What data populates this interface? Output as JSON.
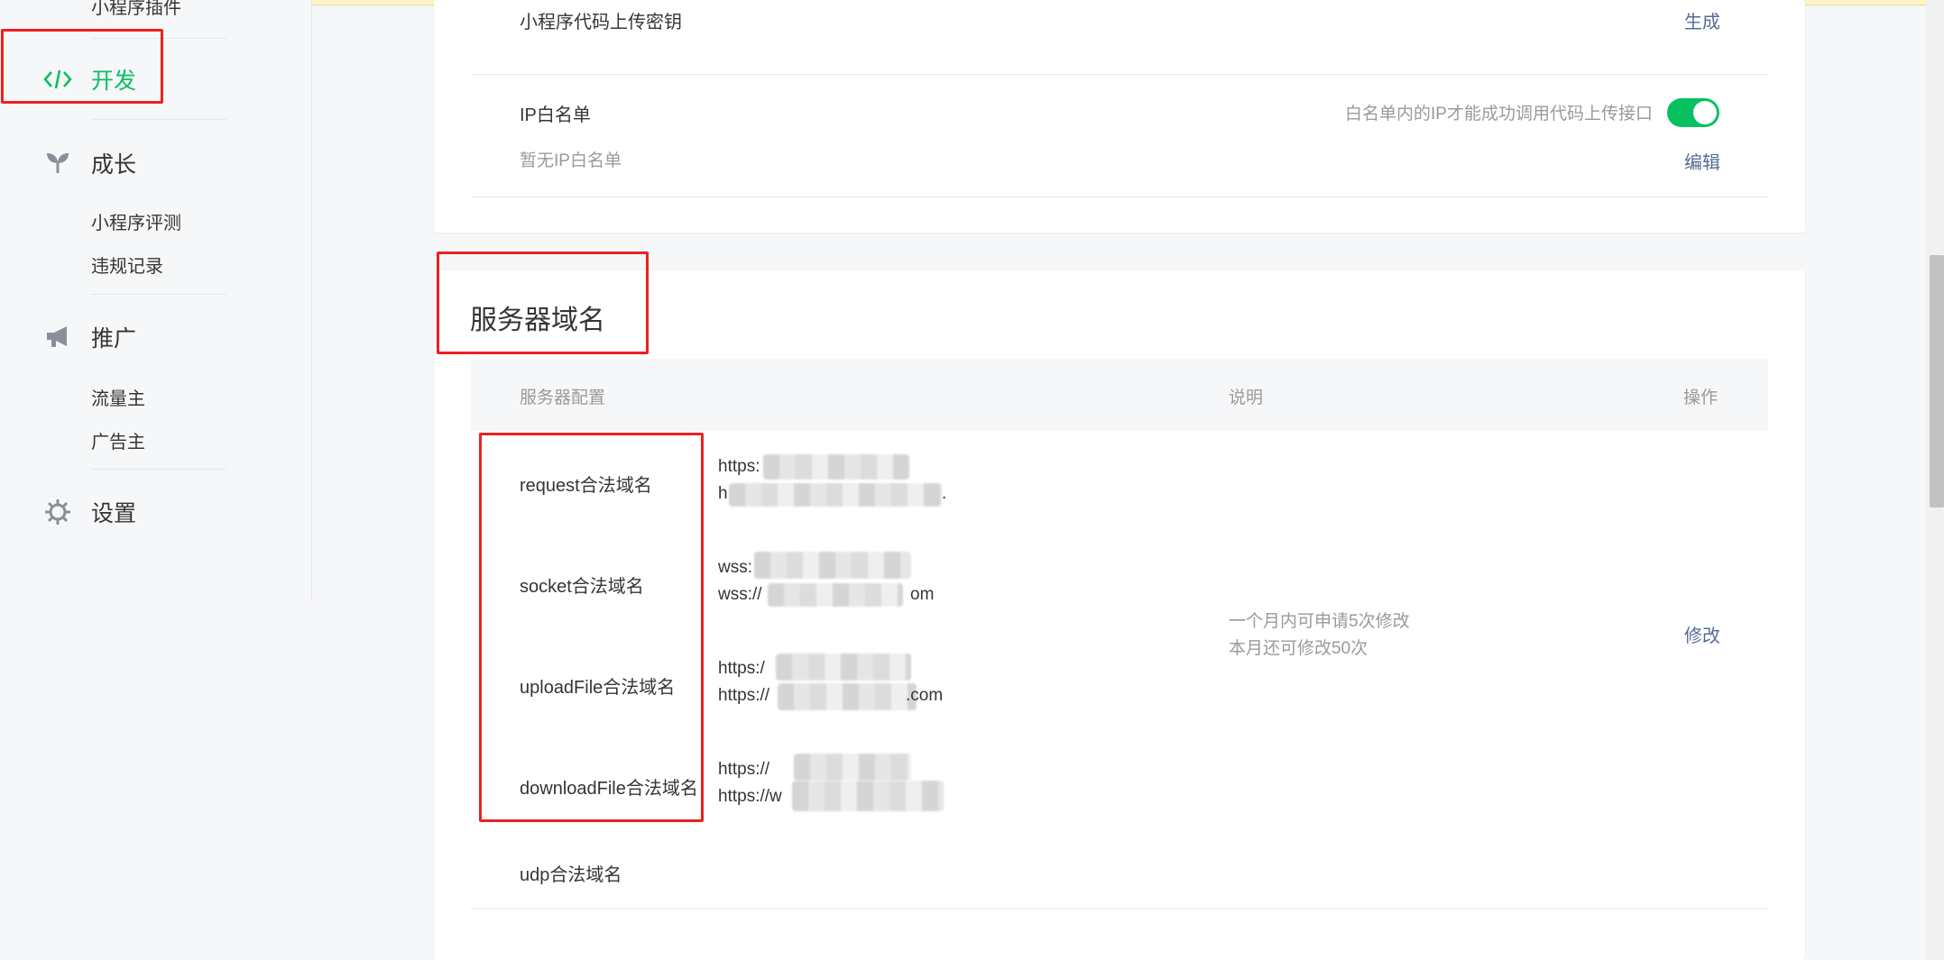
{
  "sidebar": {
    "top_cut_item": "小程序插件",
    "dev": {
      "label": "开发",
      "icon": "code-icon",
      "color": "#07c160"
    },
    "growth": {
      "label": "成长",
      "icon": "sprout-icon",
      "items": [
        "小程序评测",
        "违规记录"
      ]
    },
    "promo": {
      "label": "推广",
      "icon": "megaphone-icon",
      "items": [
        "流量主",
        "广告主"
      ]
    },
    "settings": {
      "label": "设置",
      "icon": "gear-icon"
    }
  },
  "upload_key": {
    "label": "小程序代码上传密钥",
    "action": "生成"
  },
  "ip_whitelist": {
    "label": "IP白名单",
    "status": "暂无IP白名单",
    "toggle_hint": "白名单内的IP才能成功调用代码上传接口",
    "toggle_on": true,
    "action": "编辑"
  },
  "server_domain": {
    "title": "服务器域名",
    "columns": {
      "config": "服务器配置",
      "desc": "说明",
      "action": "操作"
    },
    "rows": [
      {
        "name": "request合法域名",
        "urls": [
          "https:",
          "h"
        ],
        "url_tail": [
          "",
          "."
        ]
      },
      {
        "name": "socket合法域名",
        "urls": [
          "wss:",
          "wss://"
        ],
        "url_tail": [
          "",
          "om"
        ]
      },
      {
        "name": "uploadFile合法域名",
        "urls": [
          "https:/",
          "https://"
        ],
        "url_tail": [
          "",
          ".com"
        ]
      },
      {
        "name": "downloadFile合法域名",
        "urls": [
          "https://",
          "https://w"
        ],
        "url_tail": [
          "",
          ""
        ]
      },
      {
        "name": "udp合法域名",
        "urls": [],
        "url_tail": []
      }
    ],
    "desc_lines": [
      "一个月内可申请5次修改",
      "本月还可修改50次"
    ],
    "modify": "修改"
  },
  "colors": {
    "accent": "#07c160",
    "link": "#576b95",
    "highlight_box": "#ee2020"
  }
}
